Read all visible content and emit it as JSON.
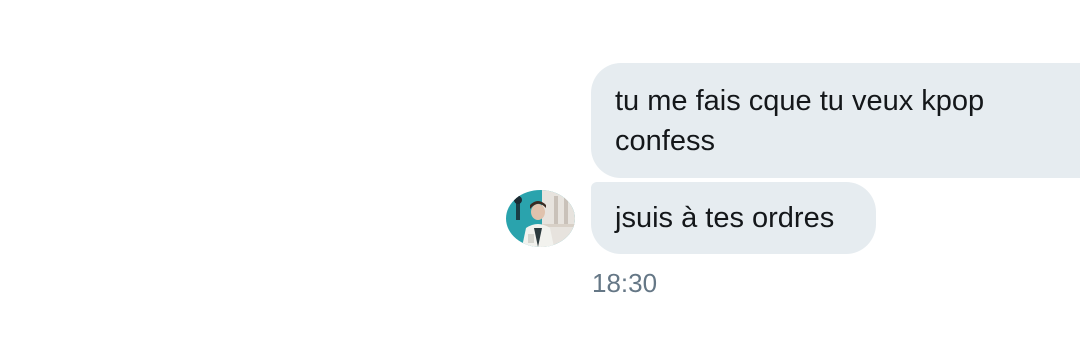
{
  "conversation": {
    "messages": [
      {
        "text": "tu me fais cque tu veux kpop\nconfess"
      },
      {
        "text": "jsuis à tes ordres"
      }
    ],
    "timestamp": "18:30",
    "avatar": {
      "icon": "user-avatar-photo"
    }
  },
  "colors": {
    "bubble_background": "#e6ecf0",
    "message_text": "#14171a",
    "timestamp_text": "#657786",
    "background": "#ffffff"
  }
}
